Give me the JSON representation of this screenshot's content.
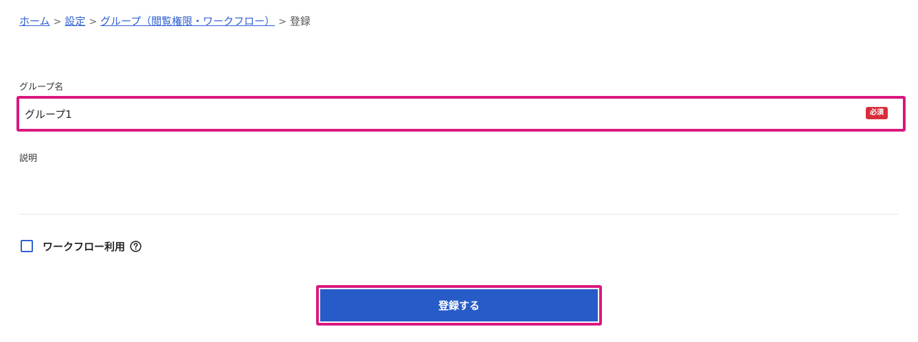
{
  "breadcrumb": {
    "home": "ホーム",
    "settings": "設定",
    "group": "グループ（閲覧権限・ワークフロー）",
    "current": "登録",
    "separator": ">"
  },
  "form": {
    "name_label": "グループ名",
    "name_value": "グループ1",
    "required_badge": "必須",
    "description_label": "説明",
    "description_value": "",
    "workflow_label": "ワークフロー利用",
    "workflow_checked": false,
    "submit_label": "登録する"
  },
  "colors": {
    "link": "#2f5fd0",
    "highlight": "#d9187f",
    "required": "#d92d3a",
    "button": "#275bc7"
  },
  "icons": {
    "help": "help-icon"
  }
}
